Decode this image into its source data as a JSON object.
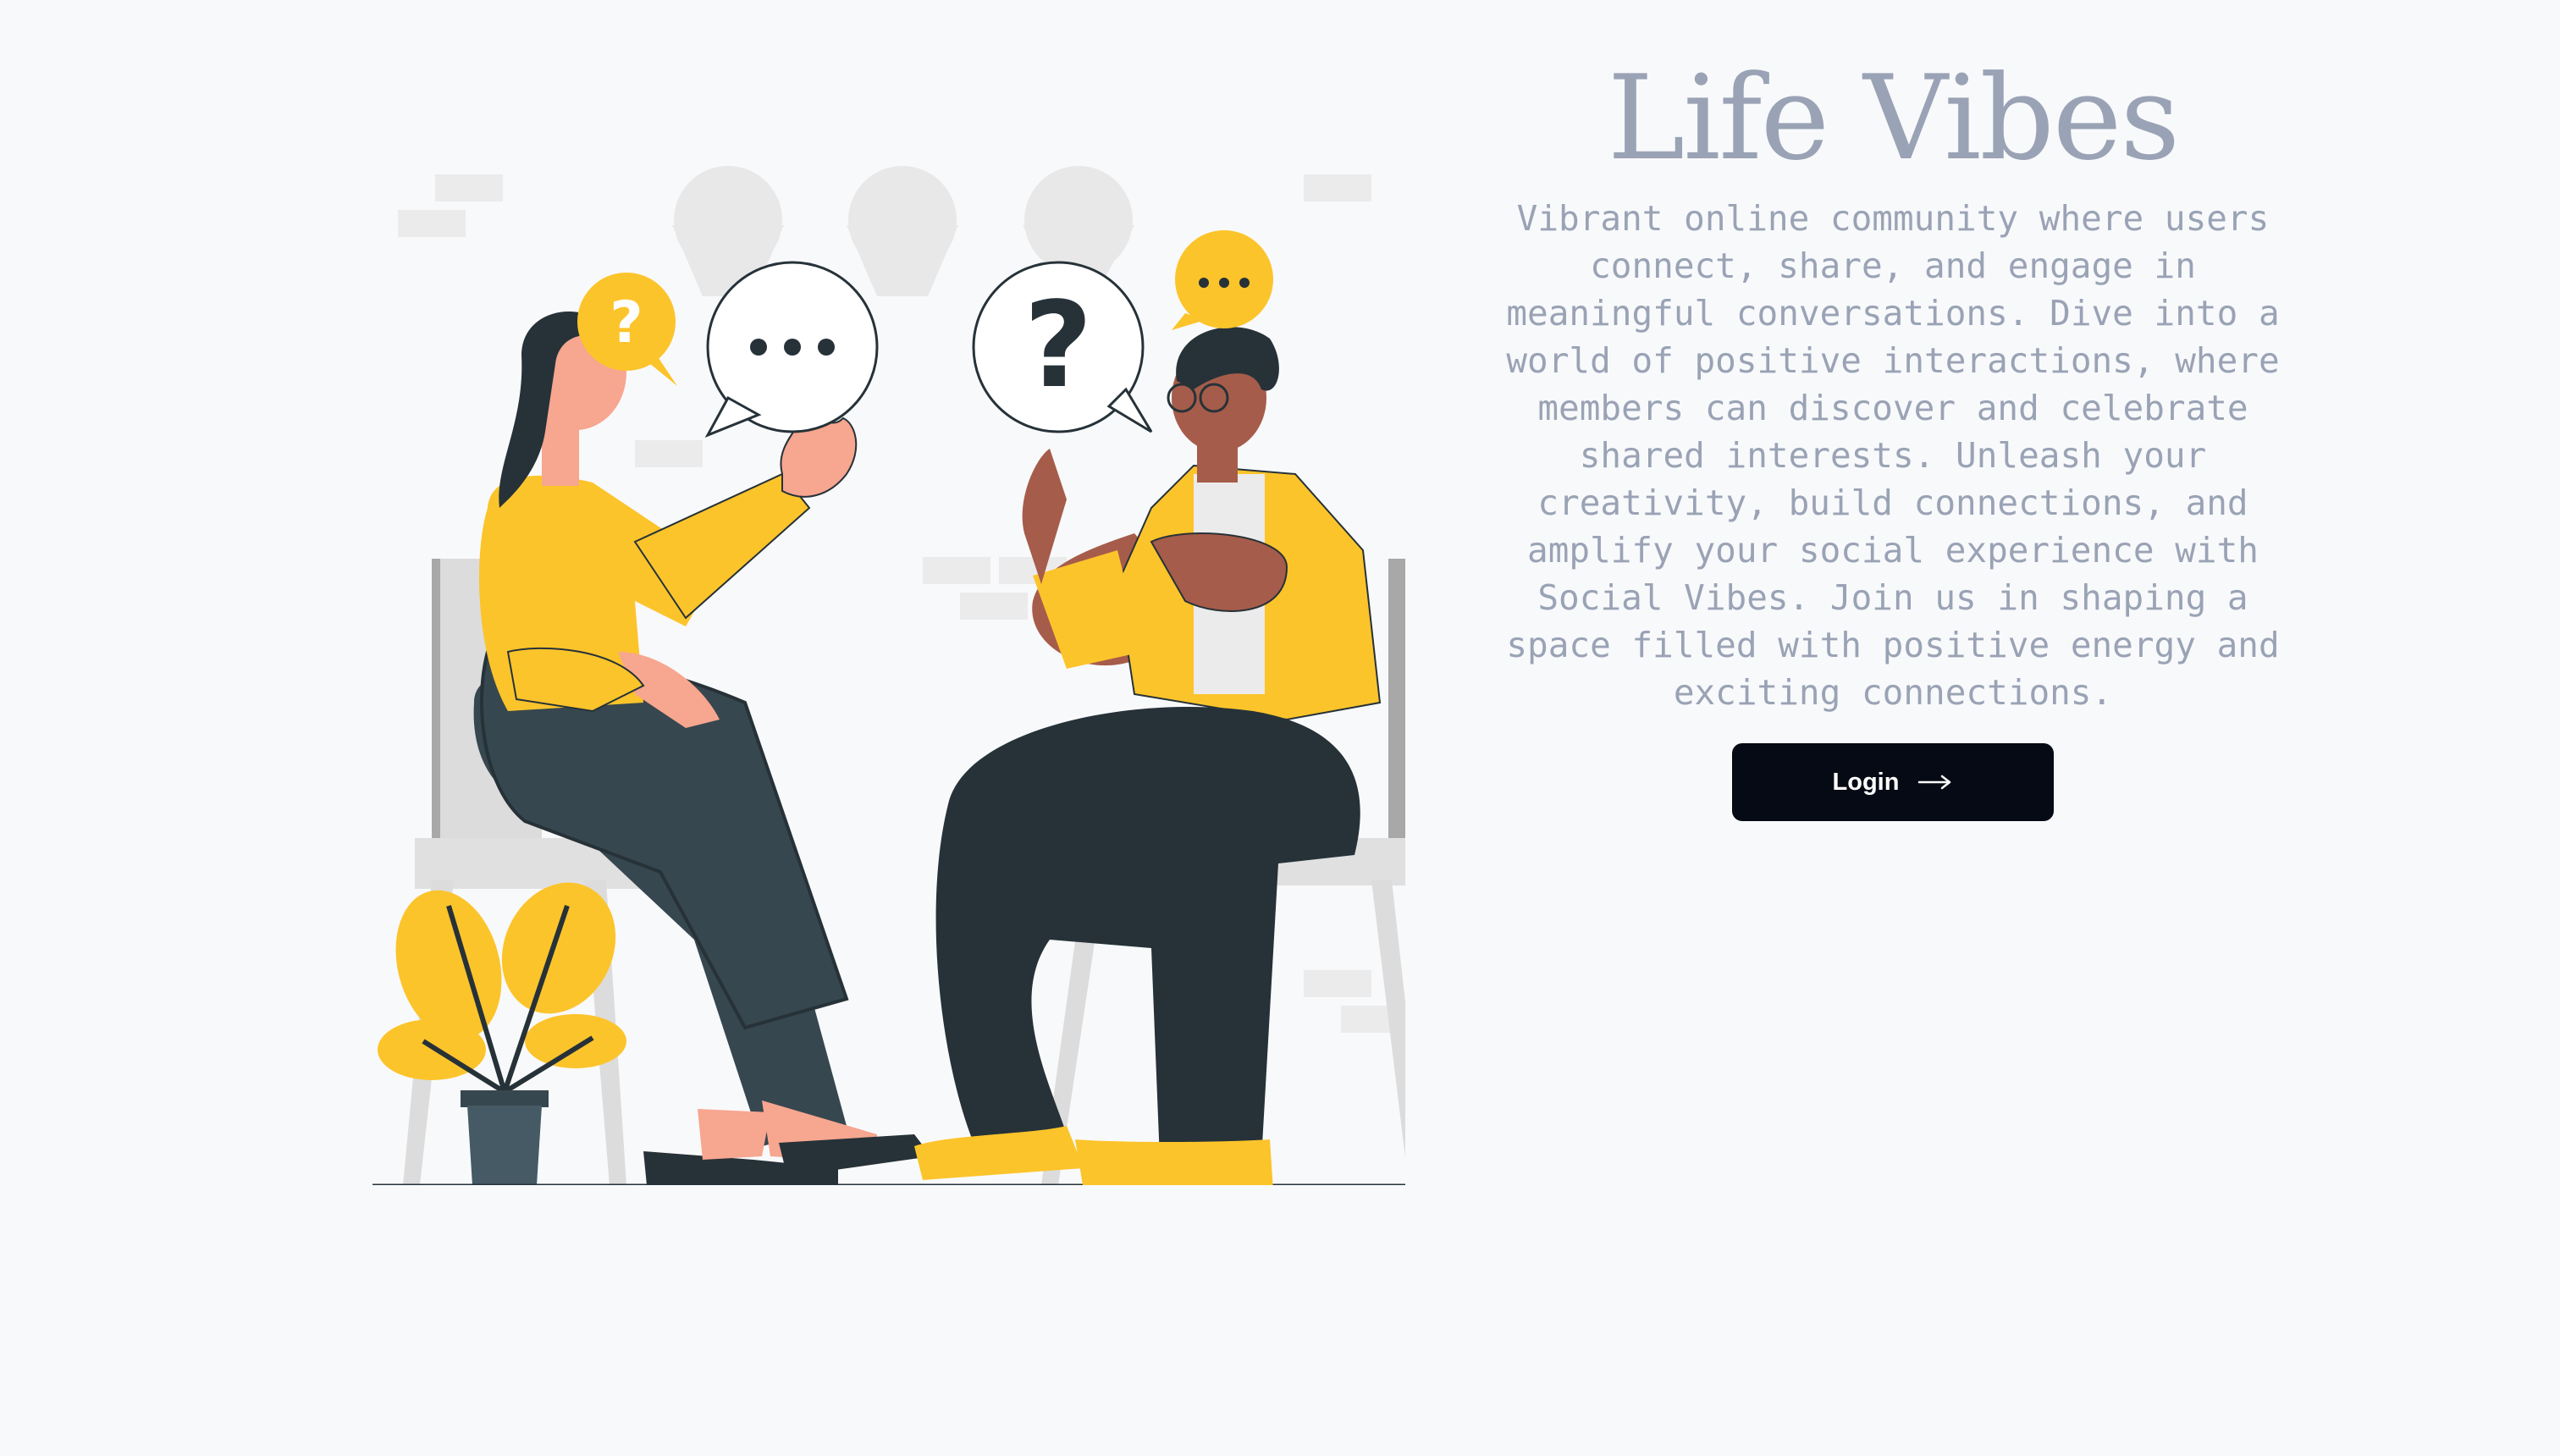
{
  "hero": {
    "title": "Life Vibes",
    "description": "Vibrant online community where users connect, share, and engage in meaningful conversations. Dive into a world of positive interactions, where members can discover and celebrate shared interests. Unleash your creativity, build connections, and amplify your social experience with Social Vibes. Join us in shaping a space filled with positive energy and exciting connections.",
    "login_label": "Login",
    "login_icon": "arrow-right-icon"
  },
  "illustration": {
    "subject": "two people conversing with speech bubbles",
    "bubble_question_mark": "?",
    "colors": {
      "accent": "#fcc42b",
      "dark": "#263238",
      "skin_light": "#f7a68f",
      "skin_dark": "#a65c4a"
    }
  }
}
